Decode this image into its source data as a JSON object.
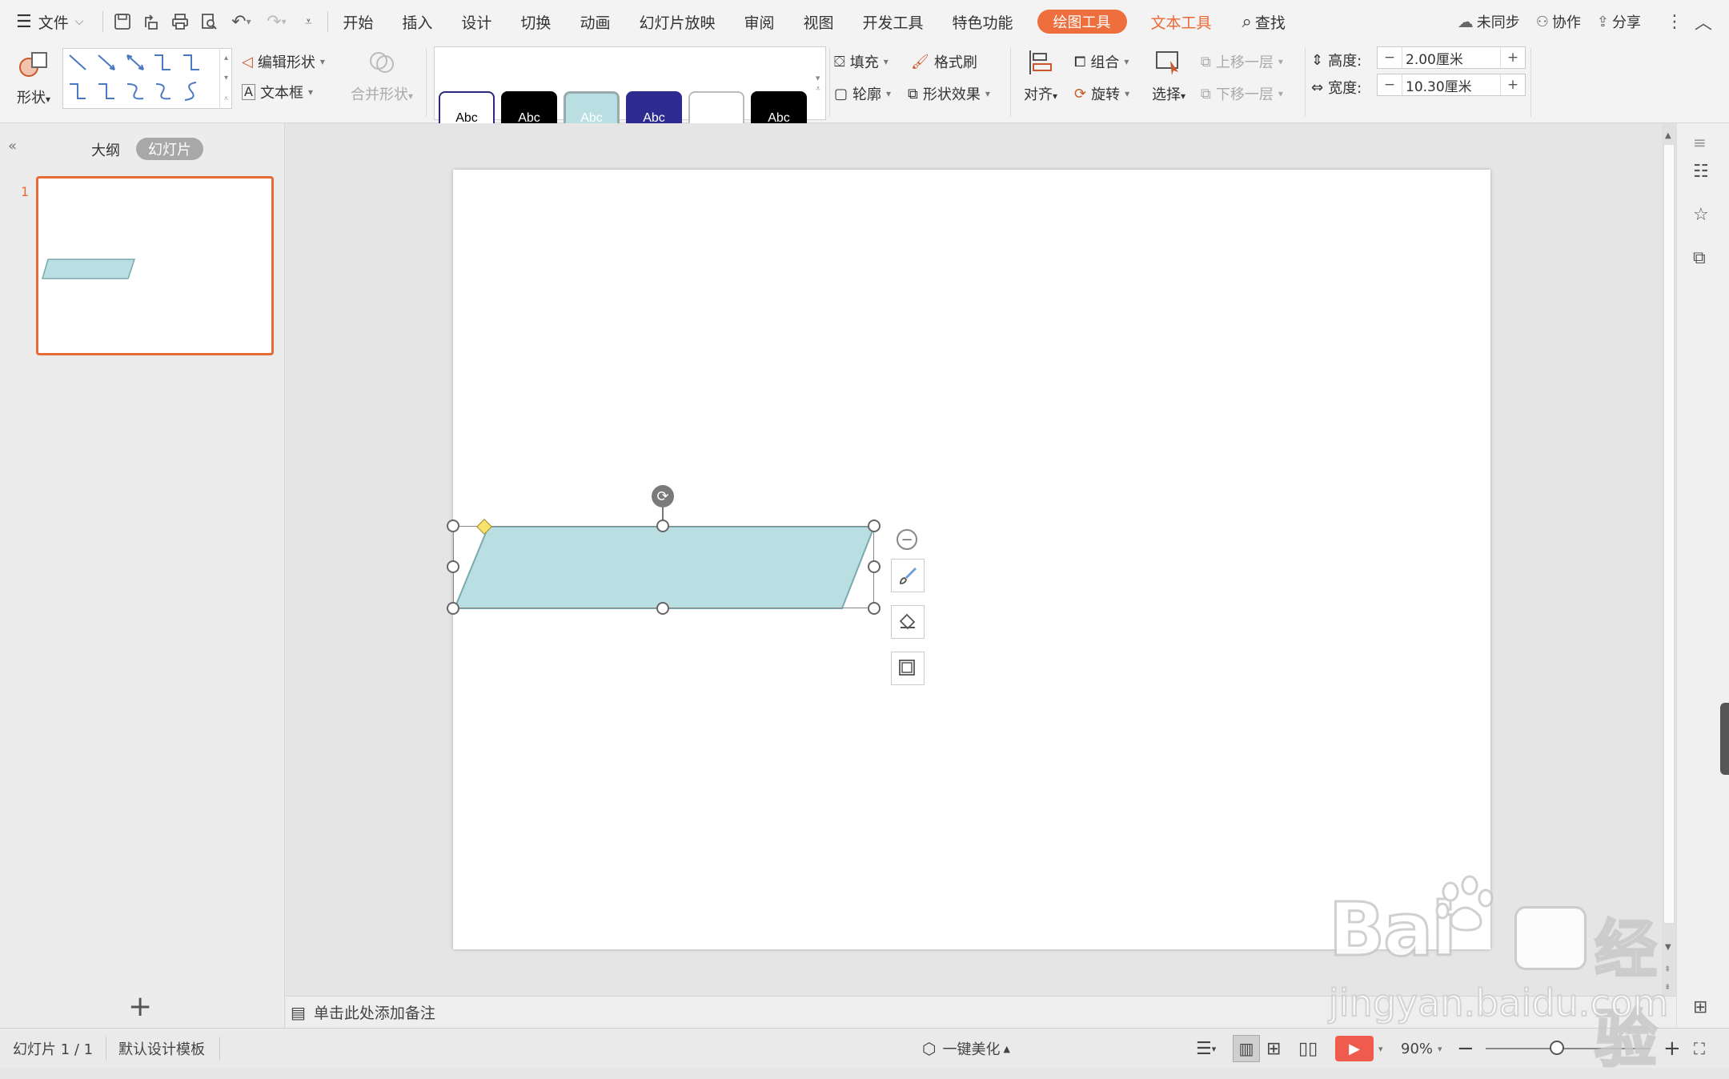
{
  "menubar": {
    "file_label": "文件",
    "tabs": [
      "开始",
      "插入",
      "设计",
      "切换",
      "动画",
      "幻灯片放映",
      "审阅",
      "视图",
      "开发工具",
      "特色功能"
    ],
    "active_tab": "绘图工具",
    "text_tools": "文本工具",
    "search_label": "查找",
    "sync_label": "未同步",
    "collab_label": "协作",
    "share_label": "分享"
  },
  "ribbon": {
    "shape_label": "形状",
    "edit_shape": "编辑形状",
    "text_box": "文本框",
    "merge_shape": "合并形状",
    "style_cards": [
      {
        "text": "Abc",
        "bg": "#ffffff",
        "fg": "#000000",
        "border": "#2b2b7a"
      },
      {
        "text": "Abc",
        "bg": "#000000",
        "fg": "#ffffff",
        "border": "#000000"
      },
      {
        "text": "Abc",
        "bg": "#b9dfe3",
        "fg": "#ffffff",
        "border": "#9aa9ad"
      },
      {
        "text": "Abc",
        "bg": "#2d2b8f",
        "fg": "#ffffff",
        "border": "#2d2b8f"
      },
      {
        "text": "",
        "bg": "#ffffff",
        "fg": "#000000",
        "border": "#bbbbbb"
      },
      {
        "text": "Abc",
        "bg": "#000000",
        "fg": "#ffffff",
        "border": "#000000"
      }
    ],
    "fill": "填充",
    "format_brush": "格式刷",
    "outline": "轮廓",
    "shape_effect": "形状效果",
    "align": "对齐",
    "group": "组合",
    "rotate": "旋转",
    "select": "选择",
    "bring_forward": "上移一层",
    "send_backward": "下移一层",
    "height_label": "高度:",
    "height_value": "2.00厘米",
    "width_label": "宽度:",
    "width_value": "10.30厘米"
  },
  "left_panel": {
    "tab_outline": "大纲",
    "tab_slides": "幻灯片",
    "slide_number": "1"
  },
  "shape": {
    "fill": "#b9dfe3",
    "stroke": "#7aa9ae"
  },
  "notes_placeholder": "单击此处添加备注",
  "status": {
    "slide_info": "幻灯片 1 / 1",
    "template": "默认设计模板",
    "beautify": "一键美化",
    "zoom": "90%"
  },
  "watermark": {
    "brand": "Bai",
    "brand2": "经验",
    "url": "jingyan.baidu.com"
  }
}
